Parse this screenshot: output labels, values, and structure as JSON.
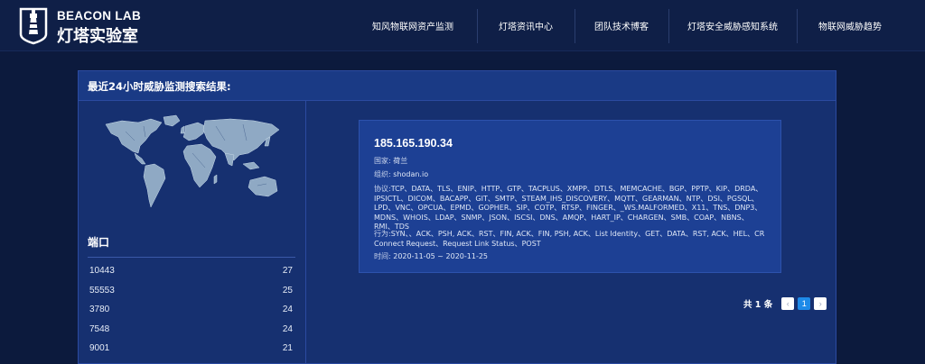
{
  "header": {
    "logo_en": "BEACON LAB",
    "logo_cn": "灯塔实验室",
    "nav": [
      {
        "label": "知风物联网资产监测",
        "width": 142
      },
      {
        "label": "灯塔资讯中心",
        "width": 108
      },
      {
        "label": "团队技术博客",
        "width": 104
      },
      {
        "label": "灯塔安全威胁感知系统",
        "width": 142
      },
      {
        "label": "物联网威胁趋势",
        "width": 118
      }
    ]
  },
  "panel": {
    "title": "最近24小时威胁监测搜索结果:"
  },
  "ports": {
    "title": "端口",
    "items": [
      {
        "port": "10443",
        "count": "27"
      },
      {
        "port": "55553",
        "count": "25"
      },
      {
        "port": "3780",
        "count": "24"
      },
      {
        "port": "7548",
        "count": "24"
      },
      {
        "port": "9001",
        "count": "21"
      }
    ]
  },
  "result": {
    "ip": "185.165.190.34",
    "country_label": "国家:",
    "country": "荷兰",
    "org_label": "组织:",
    "org": "shodan.io",
    "protocol_label": "协议:",
    "protocols": "TCP、DATA、TLS、ENIP、HTTP、GTP、TACPLUS、XMPP、DTLS、MEMCACHE、BGP、PPTP、KIP、DRDA、IPSICTL、DICOM、BACAPP、GIT、SMTP、STEAM_IHS_DISCOVERY、MQTT、GEARMAN、NTP、DSI、PGSQL、LPD、VNC、OPCUA、EPMD、GOPHER、SIP、COTP、RTSP、FINGER、_WS.MALFORMED、X11、TNS、DNP3、MDNS、WHOIS、LDAP、SNMP、JSON、ISCSI、DNS、AMQP、HART_IP、CHARGEN、SMB、COAP、NBNS、RMI、TDS",
    "behavior_label": "行为:",
    "behaviors": "SYN、、ACK、PSH, ACK、RST、FIN, ACK、FIN, PSH, ACK、List Identity、GET、DATA、RST, ACK、HEL、CR Connect Request、Request Link Status、POST",
    "time_label": "时间:",
    "time": "2020-11-05 ~ 2020-11-25"
  },
  "pagination": {
    "total": "共 1 条",
    "prev": "‹",
    "current": "1",
    "next": "›"
  },
  "colors": {
    "background": "#0c1a3d",
    "header": "#0f1f47",
    "panel": "#163070",
    "card": "#1d4094",
    "active_page": "#1e8ae8"
  },
  "icons": [
    "lighthouse-logo-icon",
    "world-map",
    "chevron-left-icon",
    "chevron-right-icon"
  ]
}
